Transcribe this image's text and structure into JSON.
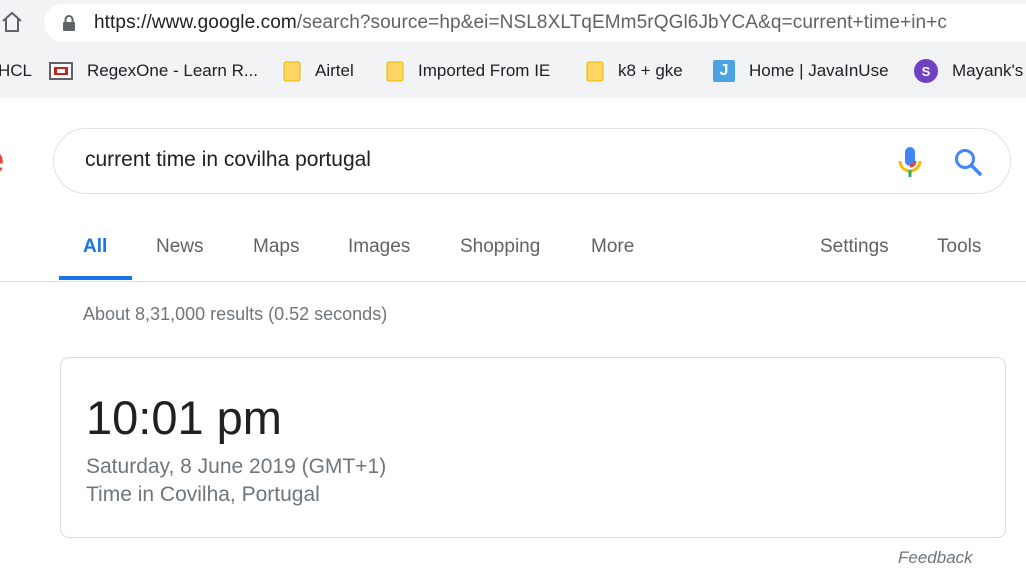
{
  "browser": {
    "url_host": "https://www.google.com",
    "url_rest": "/search?source=hp&ei=NSL8XLTqEMm5rQGl6JbYCA&q=current+time+in+c",
    "bookmarks": [
      {
        "label": "HCL",
        "icon": "none"
      },
      {
        "label": "RegexOne - Learn R...",
        "icon": "regexone-icon"
      },
      {
        "label": "Airtel",
        "icon": "folder-icon"
      },
      {
        "label": "Imported From IE",
        "icon": "folder-icon"
      },
      {
        "label": "k8 + gke",
        "icon": "folder-icon"
      },
      {
        "label": "Home | JavaInUse",
        "icon": "javainuse-icon",
        "icon_text": "J"
      },
      {
        "label": "Mayank's",
        "icon": "avatar-icon",
        "icon_text": "S"
      }
    ]
  },
  "logo_fragment": "e",
  "search": {
    "query": "current time in covilha portugal"
  },
  "tabs": {
    "all": "All",
    "news": "News",
    "maps": "Maps",
    "images": "Images",
    "shopping": "Shopping",
    "more": "More",
    "settings": "Settings",
    "tools": "Tools"
  },
  "result_stats": "About 8,31,000 results (0.52 seconds)",
  "time_card": {
    "time": "10:01 pm",
    "date": "Saturday, 8 June 2019 (GMT+1)",
    "location": "Time in Covilha, Portugal"
  },
  "feedback": "Feedback",
  "colors": {
    "accent": "#1a73e8",
    "chrome_bg": "#f1f3f4",
    "text_secondary": "#70757a"
  }
}
